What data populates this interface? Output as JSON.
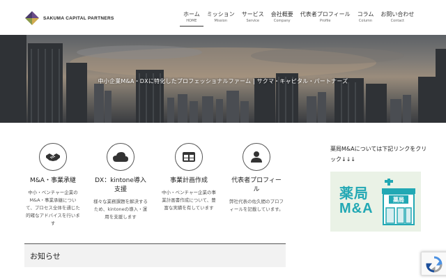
{
  "header": {
    "logo_text": "SAKUMA CAPITAL PARTNERS",
    "logo_icon": "diamond-logo-icon"
  },
  "nav": [
    {
      "jp": "ホーム",
      "en": "HOME",
      "active": true
    },
    {
      "jp": "ミッション",
      "en": "Mission"
    },
    {
      "jp": "サービス",
      "en": "Service"
    },
    {
      "jp": "会社概要",
      "en": "Company"
    },
    {
      "jp": "代表者プロフィール",
      "en": "Profile"
    },
    {
      "jp": "コラム",
      "en": "Column"
    },
    {
      "jp": "お問い合わせ",
      "en": "Contact"
    }
  ],
  "hero": {
    "caption": "中小企業M&A・DXに特化したプロフェッショナルファーム | サクマ・キャピタル・パートナーズ"
  },
  "services": [
    {
      "icon": "handshake-icon",
      "title": "M&A・事業承継",
      "desc": "中小・ベンチャー企業のM&A・事業承継について、プロセス全体を通じた的確なアドバイスを行います"
    },
    {
      "icon": "cloud-icon",
      "title": "DX：kintone導入支援",
      "desc": "様々な業務課題を解決するため、kintoneの導入・運用を支援します"
    },
    {
      "icon": "table-icon",
      "title": "事業計画作成",
      "desc": "中小・ベンチャー企業の事業計画書作成について、豊富な実績を有しています"
    },
    {
      "icon": "user-icon",
      "title": "代表者プロフィール",
      "desc": "弊社代表の佐久間のプロフィールを記載しています。"
    }
  ],
  "news": {
    "title": "お知らせ"
  },
  "sidebar": {
    "text": "薬局M&Aについては下記リンクをクリック↓↓↓",
    "banner_line1": "薬局",
    "banner_line2": "M&A",
    "banner_sign": "薬局",
    "banner_icon": "pharmacy-building-icon"
  },
  "colors": {
    "accent": "#22a8b4",
    "banner_bg": "#eaf2e6",
    "news_bg": "#f2f2f2"
  }
}
